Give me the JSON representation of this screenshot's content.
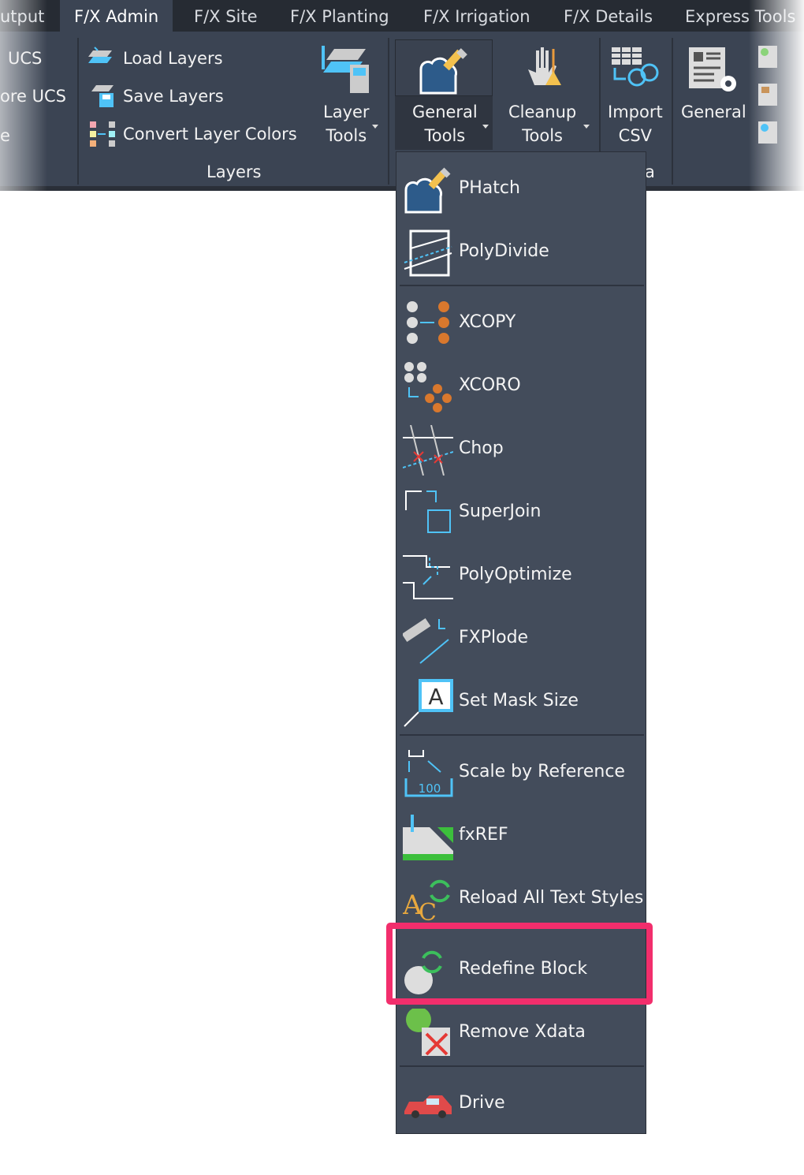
{
  "tabs": [
    "utput",
    "F/X Admin",
    "F/X Site",
    "F/X Planting",
    "F/X Irrigation",
    "F/X Details",
    "Express Tools"
  ],
  "active_tab": "F/X Admin",
  "ribbon": {
    "ucs_items": [
      "UCS",
      "ore UCS",
      "e"
    ],
    "layers_panel": {
      "title": "Layers",
      "items": [
        "Load Layers",
        "Save Layers",
        "Convert Layer Colors"
      ],
      "layer_tools": [
        "Layer",
        "Tools"
      ]
    },
    "general_tools": [
      "General",
      "Tools"
    ],
    "cleanup_tools": [
      "Cleanup",
      "Tools"
    ],
    "import_csv": [
      "Import",
      "CSV"
    ],
    "general": "General",
    "partial_panel_label": "a"
  },
  "menu": {
    "items": [
      {
        "label": "PHatch",
        "icon": "phatch-icon"
      },
      {
        "label": "PolyDivide",
        "icon": "polydivide-icon"
      },
      {
        "label": "XCOPY",
        "icon": "xcopy-icon"
      },
      {
        "label": "XCORO",
        "icon": "xcoro-icon"
      },
      {
        "label": "Chop",
        "icon": "chop-icon"
      },
      {
        "label": "SuperJoin",
        "icon": "superjoin-icon"
      },
      {
        "label": "PolyOptimize",
        "icon": "polyoptimize-icon"
      },
      {
        "label": "FXPlode",
        "icon": "fxplode-icon"
      },
      {
        "label": "Set Mask Size",
        "icon": "mask-icon"
      },
      {
        "label": "Scale by Reference",
        "icon": "scale-icon",
        "badge": "100"
      },
      {
        "label": "fxREF",
        "icon": "fxref-icon"
      },
      {
        "label": "Reload All Text Styles",
        "icon": "reload-text-icon"
      },
      {
        "label": "Redefine Block",
        "icon": "redefine-block-icon"
      },
      {
        "label": "Remove Xdata",
        "icon": "remove-xdata-icon"
      },
      {
        "label": "Drive",
        "icon": "drive-icon"
      }
    ],
    "mask_letter": "A",
    "highlighted": "Redefine Block"
  },
  "colors": {
    "highlight": "#f22e6c",
    "menu_bg": "#434c5b",
    "ribbon_bg": "#3b4453",
    "tabbar_bg": "#262b33"
  }
}
